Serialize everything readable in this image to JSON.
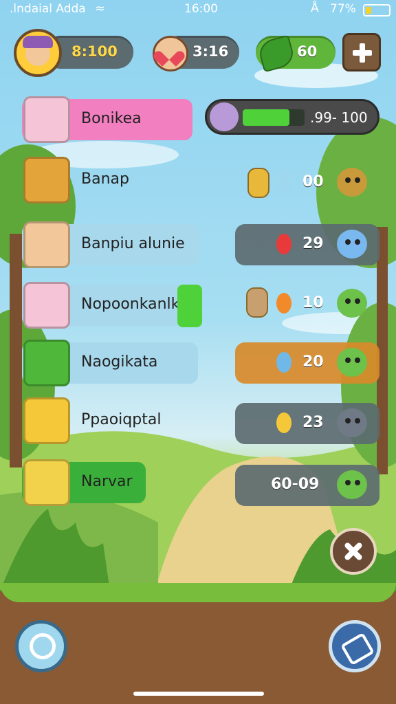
{
  "status_bar": {
    "carrier": ".lndaial Adda",
    "time": "16:00",
    "battery": "77%"
  },
  "top_bar": {
    "coins": "8:100",
    "hearts": "3:16",
    "leaves": "60"
  },
  "progress": {
    "text": ".99- 100",
    "fraction": 0.75
  },
  "menu": [
    {
      "label": "Bonikea",
      "bg": "#f27fbf",
      "icon": "grandma-portrait-icon"
    },
    {
      "label": "Banap",
      "bg": "",
      "icon": "notice-board-icon"
    },
    {
      "label": "Banpiu alunie",
      "bg": "#a8d8ec",
      "icon": "boy-reading-icon"
    },
    {
      "label": "Nopoonkanlka",
      "bg": "#a8d8ec",
      "icon": "old-man-portrait-icon"
    },
    {
      "label": "Naogikata",
      "bg": "#a8d8ec",
      "icon": "green-board-icon"
    },
    {
      "label": "Ppaoiqptal",
      "bg": "",
      "icon": "bomb-icon"
    },
    {
      "label": "Narvar",
      "bg": "#3ab03a",
      "icon": "pencil-icon"
    }
  ],
  "stats": [
    {
      "value": "00",
      "panel": false
    },
    {
      "value": "29",
      "panel": true,
      "color": "#5c6b70"
    },
    {
      "value": "10",
      "panel": false
    },
    {
      "value": "20",
      "panel": true,
      "color": "#d88a2a"
    },
    {
      "value": "23",
      "panel": true,
      "color": "#5c6b70"
    },
    {
      "value": "60-09",
      "panel": true,
      "color": "#5c6b70"
    }
  ]
}
